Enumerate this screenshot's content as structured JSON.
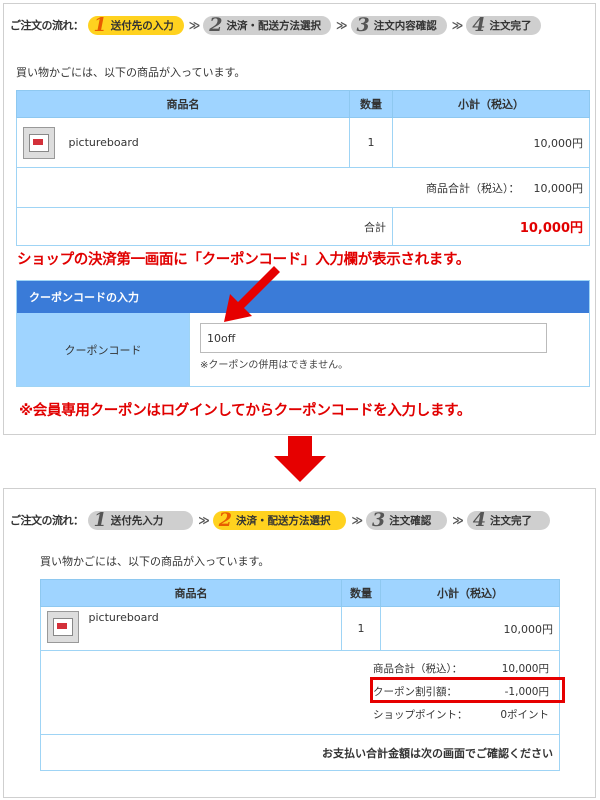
{
  "panel1": {
    "flow": {
      "label": "ご注文の流れ：",
      "steps": [
        {
          "num": "1",
          "label": "送付先の入力"
        },
        {
          "num": "2",
          "label": "決済・配送方法選択"
        },
        {
          "num": "3",
          "label": "注文内容確認"
        },
        {
          "num": "4",
          "label": "注文完了"
        }
      ],
      "separator": "≫"
    },
    "intro": "買い物かごには、以下の商品が入っています。",
    "table": {
      "headers": [
        "商品名",
        "数量",
        "小計（税込）"
      ],
      "item": {
        "name": "pictureboard",
        "qty": "1",
        "subtotal": "10,000円"
      },
      "tax_total_label": "商品合計（税込）：",
      "tax_total_value": "10,000円",
      "total_label": "合計",
      "total_value": "10,000円"
    },
    "annotation_top": "ショップの決済第一画面に「クーポンコード」入力欄が表示されます。",
    "coupon": {
      "header": "クーポンコードの入力",
      "label": "クーポンコード",
      "value": "10off",
      "note": "※クーポンの併用はできません。"
    },
    "annotation_bottom": "※会員専用クーポンはログインしてからクーポンコードを入力します。"
  },
  "panel2": {
    "flow": {
      "label": "ご注文の流れ：",
      "steps": [
        {
          "num": "1",
          "label": "送付先入力"
        },
        {
          "num": "2",
          "label": "決済・配送方法選択"
        },
        {
          "num": "3",
          "label": "注文確認"
        },
        {
          "num": "4",
          "label": "注文完了"
        }
      ],
      "separator": "≫"
    },
    "intro": "買い物かごには、以下の商品が入っています。",
    "table": {
      "headers": [
        "商品名",
        "数量",
        "小計（税込）"
      ],
      "item": {
        "name": "pictureboard",
        "qty": "1",
        "subtotal": "10,000円"
      },
      "summary": [
        {
          "label": "商品合計（税込）：",
          "value": "10,000円"
        },
        {
          "label": "クーポン割引額：",
          "value": "-1,000円"
        },
        {
          "label": "ショップポイント：",
          "value": "0ポイント"
        }
      ],
      "note": "お支払い合計金額は次の画面でご確認ください"
    }
  },
  "colors": {
    "header_blue": "#9fd4ff",
    "coupon_head": "#3a7bd8",
    "active_step": "#ffd21f",
    "inactive_step": "#cfcfcf",
    "accent_red": "#e10000"
  }
}
